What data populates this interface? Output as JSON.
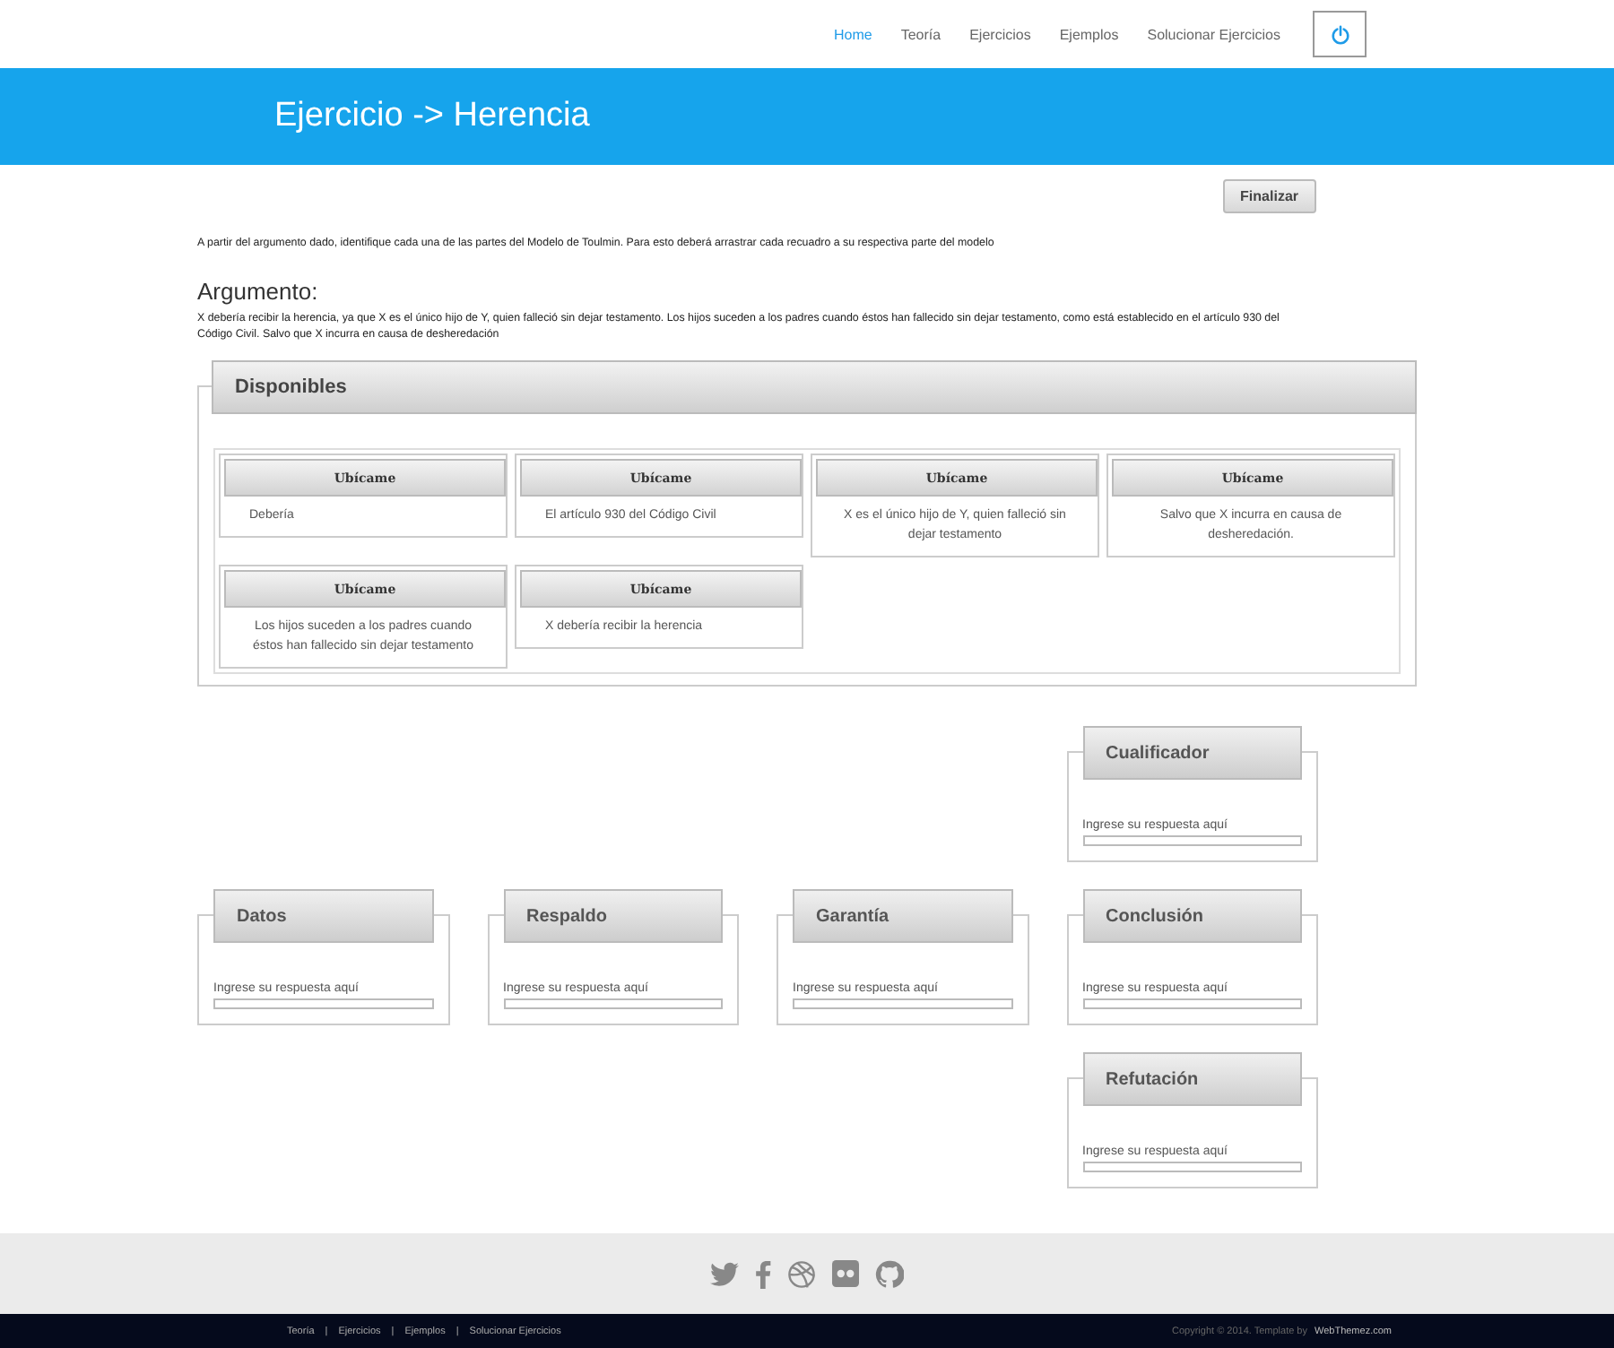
{
  "nav": {
    "items": [
      {
        "label": "Home",
        "selected": true
      },
      {
        "label": "Teoría",
        "selected": false
      },
      {
        "label": "Ejercicios",
        "selected": false
      },
      {
        "label": "Ejemplos",
        "selected": false
      },
      {
        "label": "Solucionar Ejercicios",
        "selected": false
      }
    ]
  },
  "banner": {
    "title": "Ejercicio -> Herencia"
  },
  "finish_button": "Finalizar",
  "instructions": "A partir del argumento dado, identifique cada una de las partes del Modelo de Toulmin. Para esto deberá arrastrar cada recuadro a su respectiva parte del modelo",
  "argument": {
    "heading": "Argumento:",
    "text": "X debería recibir la herencia, ya que X es el único hijo de Y, quien falleció sin dejar testamento. Los hijos suceden a los padres cuando éstos han fallecido sin dejar testamento, como está establecido en el artículo 930 del Código Civil. Salvo que X incurra en causa de desheredación"
  },
  "available": {
    "title": "Disponibles",
    "cards": [
      {
        "handle": "Ubícame",
        "text": "Debería",
        "kind": "short"
      },
      {
        "handle": "Ubícame",
        "text": "El artículo 930 del Código Civil",
        "kind": "short"
      },
      {
        "handle": "Ubícame",
        "text": "X es el único hijo de Y, quien falleció sin dejar testamento",
        "kind": "long"
      },
      {
        "handle": "Ubícame",
        "text": "Salvo que X incurra en causa de desheredación.",
        "kind": "long"
      },
      {
        "handle": "Ubícame",
        "text": "Los hijos suceden a los padres cuando éstos han fallecido sin dejar testamento",
        "kind": "long"
      },
      {
        "handle": "Ubícame",
        "text": "X debería recibir la herencia",
        "kind": "short"
      }
    ]
  },
  "model": {
    "rows": [
      {
        "slots": [
          {
            "title": "Cualificador",
            "prompt": "Ingrese su respuesta aquí"
          }
        ]
      },
      {
        "slots": [
          {
            "title": "Datos",
            "prompt": "Ingrese su respuesta aquí"
          },
          {
            "title": "Respaldo",
            "prompt": "Ingrese su respuesta aquí"
          },
          {
            "title": "Garantía",
            "prompt": "Ingrese su respuesta aquí"
          },
          {
            "title": "Conclusión",
            "prompt": "Ingrese su respuesta aquí"
          }
        ]
      },
      {
        "slots": [
          {
            "title": "Refutación",
            "prompt": "Ingrese su respuesta aquí"
          }
        ]
      }
    ]
  },
  "footer": {
    "links": [
      "Teoría",
      "|",
      "Ejercicios",
      "|",
      "Ejemplos",
      "|",
      "Solucionar Ejercicios"
    ],
    "copyright": "Copyright © 2014. Template by",
    "credit": "WebThemez.com"
  }
}
